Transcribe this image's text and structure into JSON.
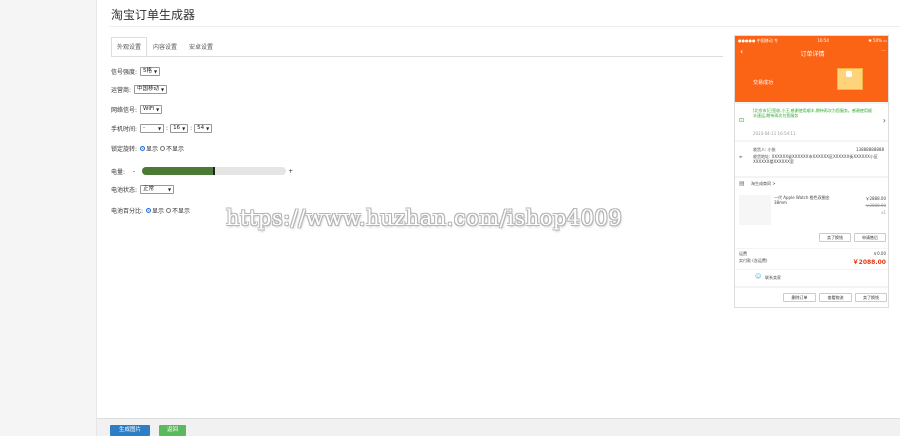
{
  "page": {
    "title": "淘宝订单生成器"
  },
  "tabs": [
    {
      "label": "外观设置",
      "active": true
    },
    {
      "label": "内容设置",
      "active": false
    },
    {
      "label": "安卓设置",
      "active": false
    }
  ],
  "form": {
    "signal": {
      "label": "信号强度:",
      "value": "5格"
    },
    "carrier": {
      "label": "运营商:",
      "value": "中国移动"
    },
    "network": {
      "label": "网络信号:",
      "value": "WiFi"
    },
    "time": {
      "label": "手机时间:",
      "ampm": "-",
      "hour": "16",
      "sep": ":",
      "minute": "54"
    },
    "rotation": {
      "label": "锁定旋转:",
      "options": [
        "显示",
        "不显示"
      ],
      "selected": "显示"
    },
    "battery": {
      "label": "电量:",
      "minus": "-",
      "plus": "+",
      "level_percent": 50
    },
    "battery_state": {
      "label": "电池状态:",
      "value": "正常"
    },
    "battery_pct": {
      "label": "电池百分比:",
      "options": [
        "显示",
        "不显示"
      ],
      "selected": "显示"
    }
  },
  "watermark": "https://www.huzhan.com/ishop4009",
  "bottom": {
    "generate_label": "生成图片",
    "back_label": "返回"
  },
  "colors": {
    "primary_btn": "#2d7ec6",
    "green_btn": "#5cb85c",
    "phone_accent": "#fb6315",
    "slider_fill": "#4b7a37"
  },
  "phone": {
    "status": {
      "left": "●●●●● 中国移动 令",
      "time": "16:54",
      "right": "✱ 50% ▭"
    },
    "nav_title": "订单详情",
    "more": "···",
    "success": "交易成功",
    "logistics": {
      "text": "[北京市]已签收,小王,感谢使用顺丰,期待再次为您服务。感谢使用顺丰速运,期待再次为您服务",
      "time": "2023-04-11 16:54:11"
    },
    "receiver": {
      "name": "收货人: 小张",
      "phone": "13888888888",
      "address": "收货地址: XXXXXX省XXXXXX市XXXXXX区XXXXXX街XXXXXX小区XXXXXX楼XXXXXX室"
    },
    "shop": "淘生成商同 >",
    "item": {
      "name": "一代 Apple Watch 橙色双圈金 38mm",
      "price": "￥2888.00",
      "orig": "￥2888.00",
      "qty": "x1"
    },
    "item_buttons": [
      "卖了换钱",
      "申请售后"
    ],
    "shipping": {
      "label": "运费",
      "value": "￥0.00"
    },
    "paid": {
      "label": "实付款 (含运费)",
      "value": "￥2088.00"
    },
    "contact": "联系卖家",
    "footer_buttons": [
      "删除订单",
      "查看物流",
      "卖了换钱"
    ]
  }
}
